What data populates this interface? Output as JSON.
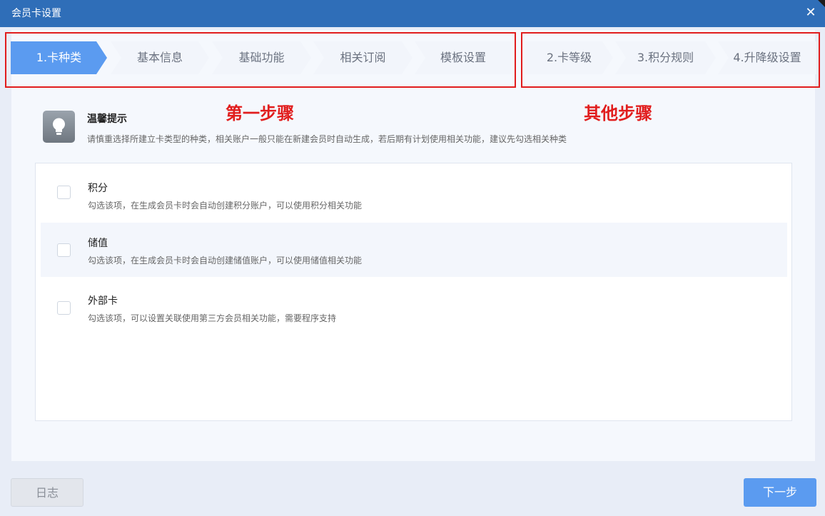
{
  "window": {
    "title": "会员卡设置",
    "close_symbol": "✕"
  },
  "steps_group1": [
    {
      "label": "1.卡种类",
      "active": true
    },
    {
      "label": "基本信息",
      "active": false
    },
    {
      "label": "基础功能",
      "active": false
    },
    {
      "label": "相关订阅",
      "active": false
    },
    {
      "label": "模板设置",
      "active": false
    }
  ],
  "steps_group2": [
    {
      "label": "2.卡等级",
      "active": false
    },
    {
      "label": "3.积分规则",
      "active": false
    },
    {
      "label": "4.升降级设置",
      "active": false
    }
  ],
  "annotations": {
    "first_step": "第一步骤",
    "other_steps": "其他步骤",
    "color": "#e11d1d"
  },
  "tip": {
    "title": "温馨提示",
    "text": "请慎重选择所建立卡类型的种类，相关账户一般只能在新建会员时自动生成，若后期有计划使用相关功能，建议先勾选相关种类",
    "icon": "lightbulb-icon"
  },
  "card_types": [
    {
      "title": "积分",
      "desc": "勾选该项，在生成会员卡时会自动创建积分账户，可以使用积分相关功能",
      "checked": false
    },
    {
      "title": "储值",
      "desc": "勾选该项，在生成会员卡时会自动创建储值账户，可以使用储值相关功能",
      "checked": false
    },
    {
      "title": "外部卡",
      "desc": "勾选该项，可以设置关联使用第三方会员相关功能，需要程序支持",
      "checked": false
    }
  ],
  "footer": {
    "log_label": "日志",
    "next_label": "下一步"
  },
  "colors": {
    "titlebar": "#2f6eb8",
    "accent": "#5b9bf0",
    "background": "#e8edf7"
  }
}
